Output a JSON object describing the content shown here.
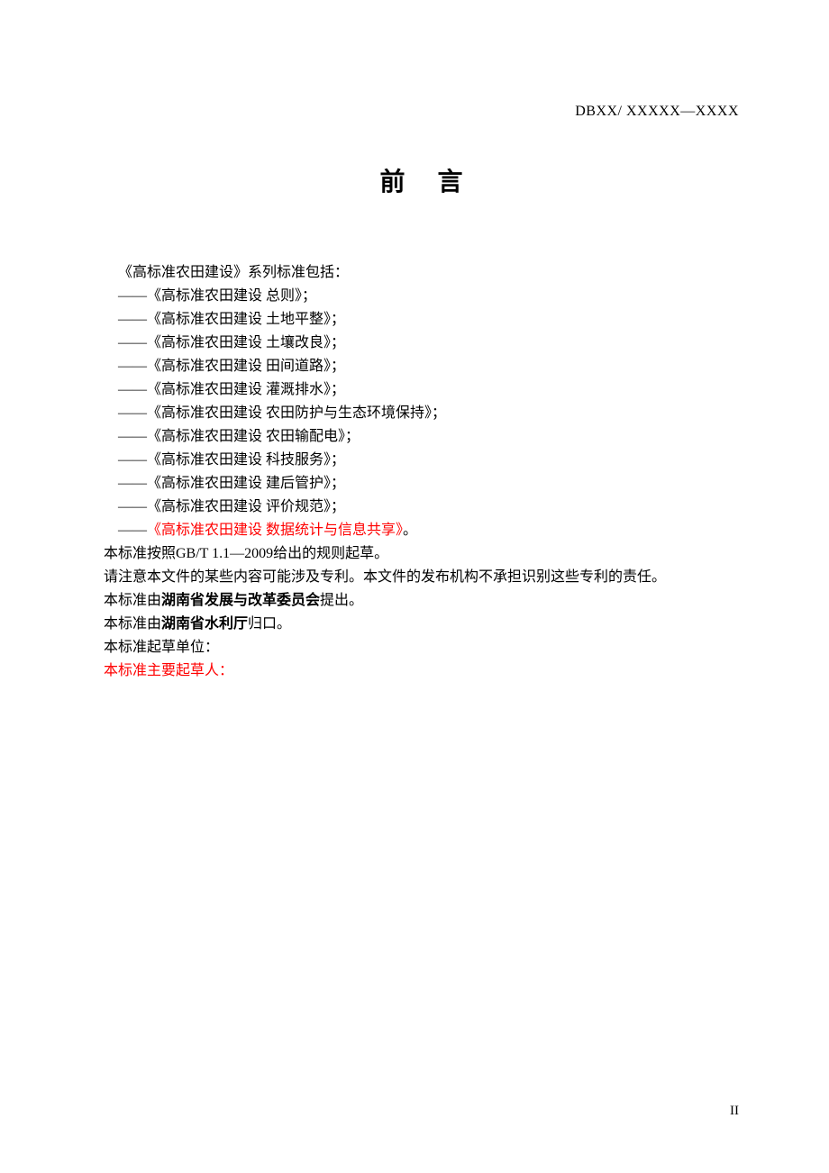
{
  "header": {
    "code": "DBXX/ XXXXX—XXXX"
  },
  "title": "前言",
  "content": {
    "intro": "《高标准农田建设》系列标准包括：",
    "items": [
      "——《高标准农田建设 总则》；",
      "——《高标准农田建设 土地平整》；",
      "——《高标准农田建设 土壤改良》；",
      "——《高标准农田建设 田间道路》；",
      "——《高标准农田建设 灌溉排水》；",
      "——《高标准农田建设 农田防护与生态环境保持》；",
      "——《高标准农田建设 农田输配电》；",
      "——《高标准农田建设 科技服务》；",
      "——《高标准农田建设 建后管护》；",
      "——《高标准农田建设 评价规范》；"
    ],
    "lastItemPrefix": "——",
    "lastItemRed": "《高标准农田建设 数据统计与信息共享》",
    "lastItemSuffix": "。",
    "p1": "本标准按照GB/T 1.1—2009给出的规则起草。",
    "p2": "请注意本文件的某些内容可能涉及专利。本文件的发布机构不承担识别这些专利的责任。",
    "p3a": "本标准由",
    "p3b": "湖南省发展与改革委员会",
    "p3c": "提出。",
    "p4a": "本标准由",
    "p4b": "湖南省水利厅",
    "p4c": "归口。",
    "p5": "本标准起草单位：",
    "p6": "本标准主要起草人："
  },
  "pageNumber": "II"
}
